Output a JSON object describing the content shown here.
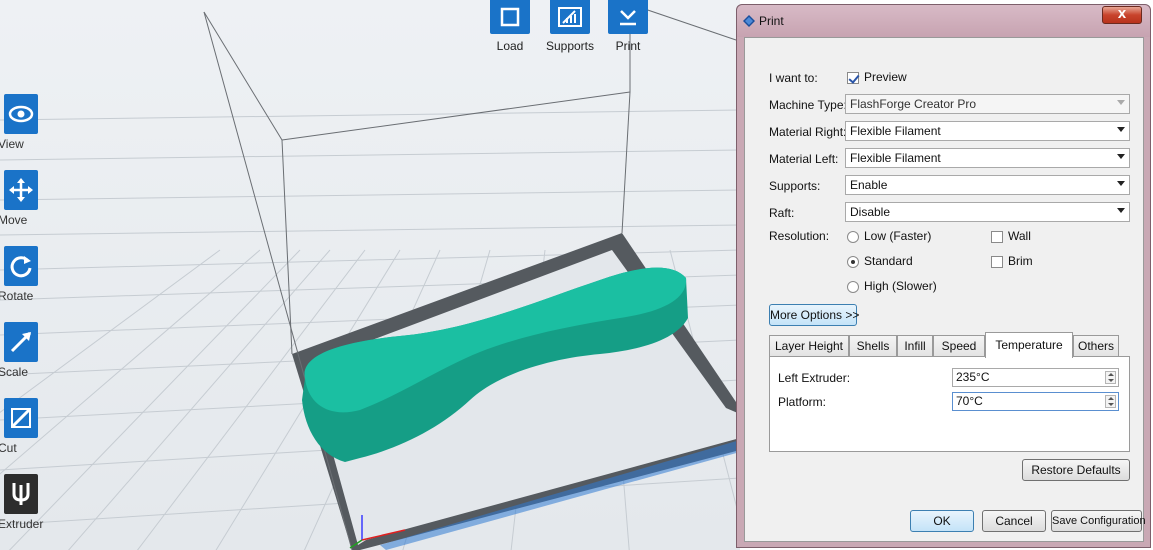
{
  "toolbar_left": [
    {
      "label": "View",
      "icon": "eye-icon"
    },
    {
      "label": "Move",
      "icon": "move-arrows-icon"
    },
    {
      "label": "Rotate",
      "icon": "rotate-icon"
    },
    {
      "label": "Scale",
      "icon": "scale-icon"
    },
    {
      "label": "Cut",
      "icon": "cut-icon"
    },
    {
      "label": "Extruder",
      "icon": "extruder-icon"
    }
  ],
  "toolbar_top": [
    {
      "label": "Load",
      "icon": "load-icon"
    },
    {
      "label": "Supports",
      "icon": "supports-icon"
    },
    {
      "label": "Print",
      "icon": "print-icon"
    }
  ],
  "dialog": {
    "title": "Print",
    "close_label": "X",
    "i_want_to_label": "I want to:",
    "preview_label": "Preview",
    "preview_checked": true,
    "machine_type_label": "Machine Type:",
    "machine_type_value": "FlashForge Creator Pro",
    "material_right_label": "Material Right:",
    "material_right_value": "Flexible Filament",
    "material_left_label": "Material Left:",
    "material_left_value": "Flexible Filament",
    "supports_label": "Supports:",
    "supports_value": "Enable",
    "raft_label": "Raft:",
    "raft_value": "Disable",
    "resolution_label": "Resolution:",
    "resolution_options": [
      "Low (Faster)",
      "Standard",
      "High (Slower)"
    ],
    "resolution_selected": "Standard",
    "wall_label": "Wall",
    "brim_label": "Brim",
    "more_options_label": "More Options >>",
    "tabs": [
      "Layer Height",
      "Shells",
      "Infill",
      "Speed",
      "Temperature",
      "Others"
    ],
    "active_tab": "Temperature",
    "left_extruder_label": "Left Extruder:",
    "left_extruder_value": "235°C",
    "platform_label": "Platform:",
    "platform_value": "70°C",
    "restore_defaults_label": "Restore Defaults",
    "ok_label": "OK",
    "cancel_label": "Cancel",
    "save_config_label": "Save Configuration"
  },
  "colors": {
    "accent": "#1a73c8",
    "model": "#1ab59a",
    "title_bar": "#c9a8b4"
  }
}
